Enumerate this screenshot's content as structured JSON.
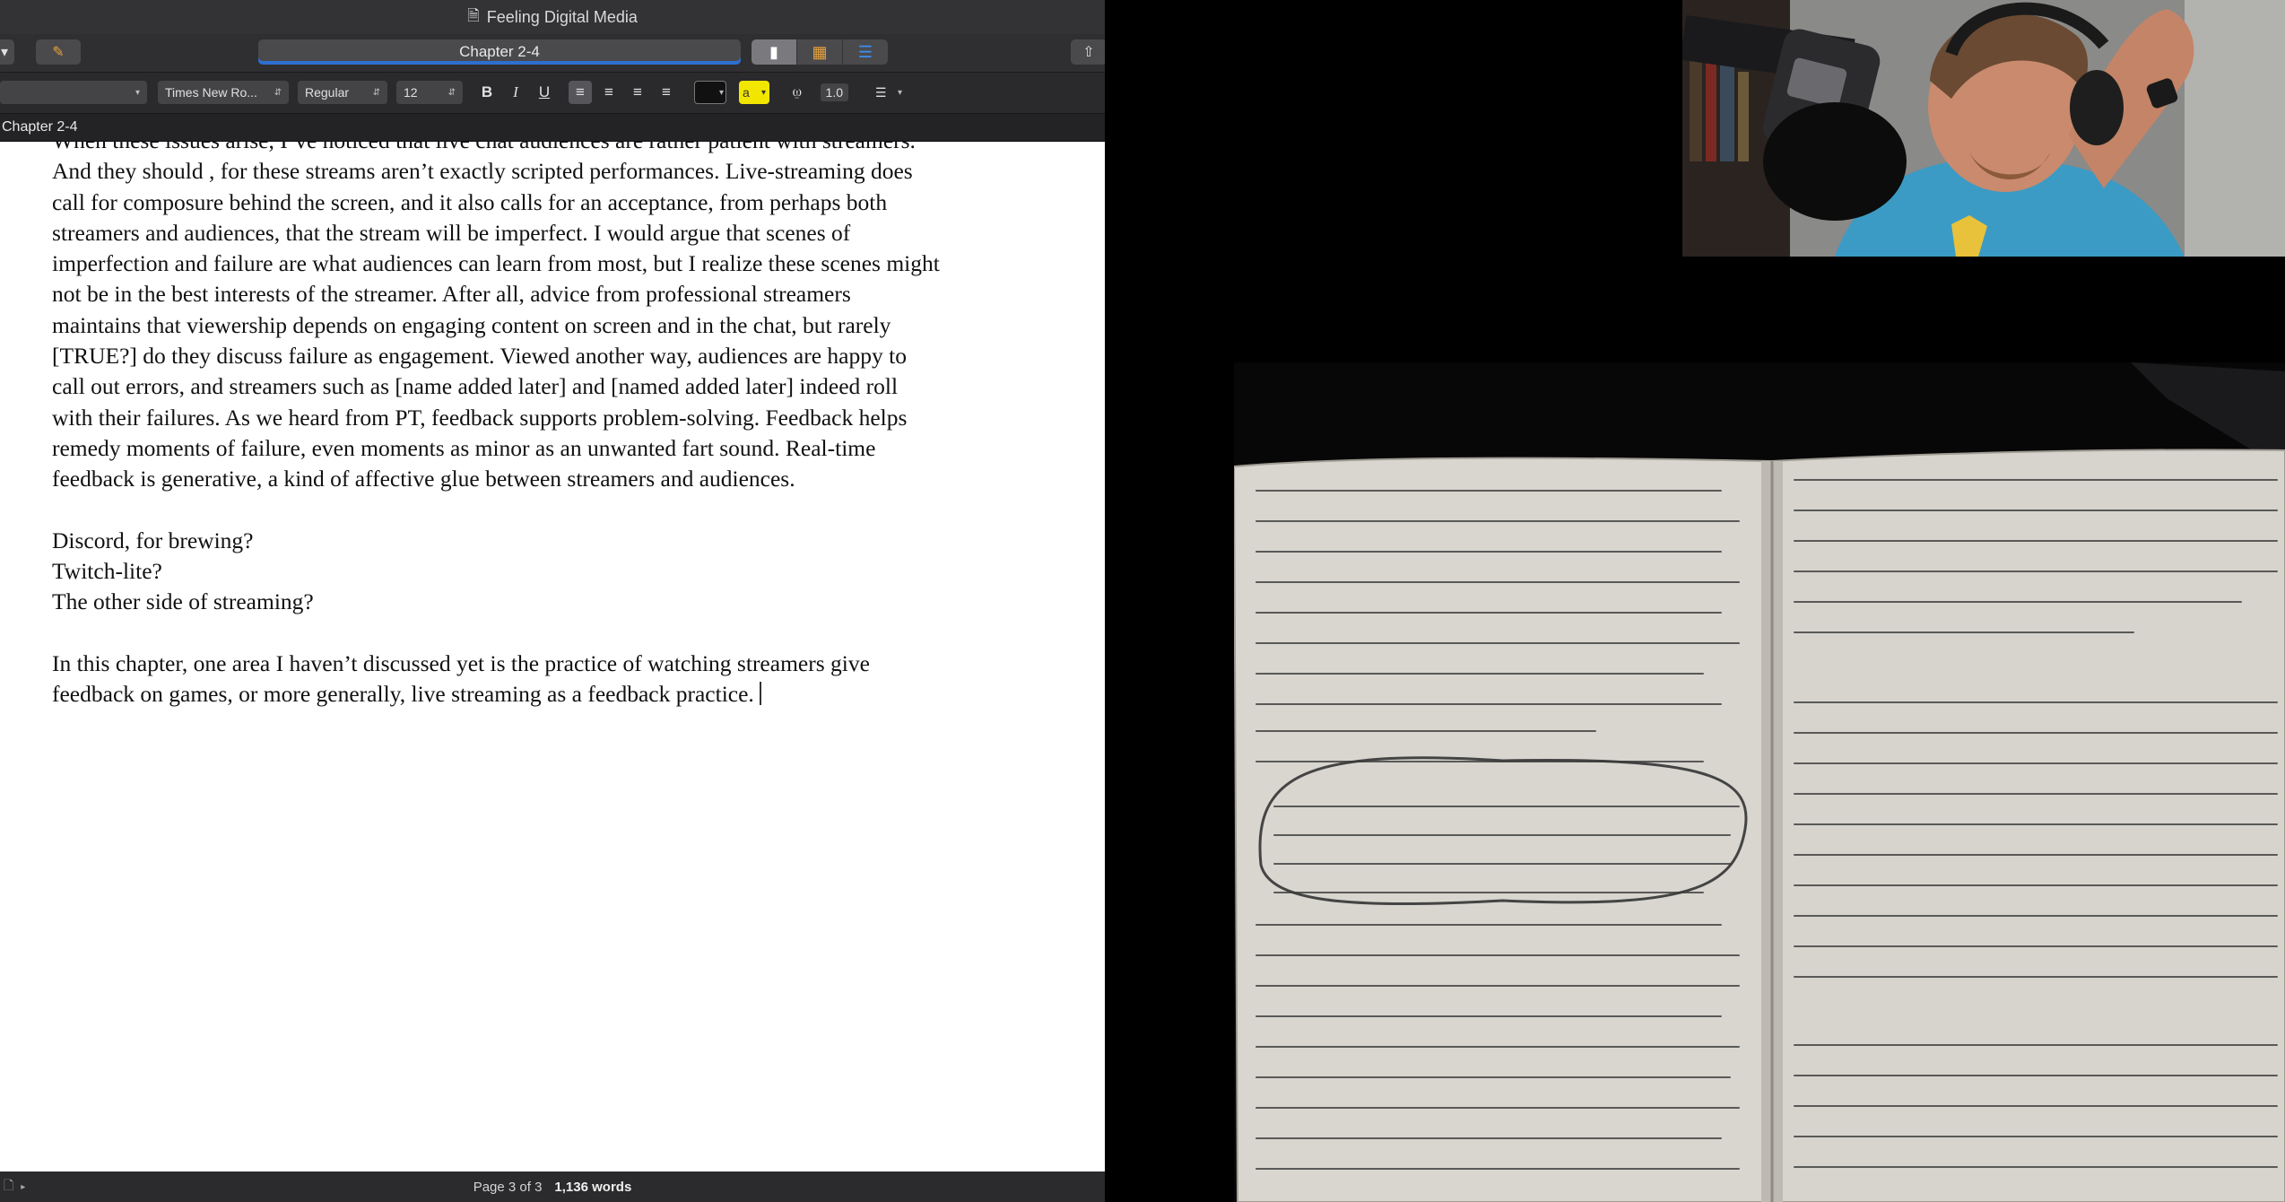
{
  "window": {
    "title": "Feeling Digital Media"
  },
  "toolbar": {
    "chapter_field": "Chapter 2-4"
  },
  "format_bar": {
    "font_family": "Times New Ro...",
    "font_style": "Regular",
    "font_size": "12",
    "line_spacing": "1.0",
    "highlight_label": "a"
  },
  "editor": {
    "header_title": "Chapter 2-4",
    "cut_off_line": "When these issues arise, I’ve noticed that live chat audiences are rather patient with streamers.",
    "paragraph1_lines": [
      "And they should , for these streams aren’t exactly scripted performances. Live-streaming does",
      "call for composure behind the screen, and it also calls for an acceptance, from perhaps both",
      "streamers and audiences, that the stream will be imperfect. I would argue that scenes of",
      "imperfection and failure are what audiences can learn from most, but I realize these scenes might",
      "not be in the best interests of the streamer. After all, advice from professional streamers",
      "maintains that viewership depends on engaging content on screen and in the chat, but rarely",
      "[TRUE?] do they discuss failure as engagement. Viewed another way, audiences are happy to",
      "call out errors, and streamers such as [name added later] and [named added later] indeed roll",
      "with their failures. As we heard from PT, feedback supports problem-solving. Feedback helps",
      "remedy moments of failure, even moments as minor as an unwanted fart sound. Real-time",
      "feedback is generative, a kind of affective glue between streamers and audiences."
    ],
    "notes": [
      "Discord, for brewing?",
      "Twitch-lite?",
      "The other side of streaming?"
    ],
    "paragraph2_lines": [
      "In this chapter, one area I haven’t discussed yet is the practice of watching streamers give",
      "feedback on games, or more generally, live streaming as a feedback practice."
    ]
  },
  "footer": {
    "page_label": "Page 3 of 3",
    "word_count": "1,136 words"
  },
  "icons": {
    "title_doc": "document-icon",
    "toolbar_left": "chevron-left-icon",
    "toolbar_compose": "compose-icon",
    "view_document": "single-document-view-icon",
    "view_corkboard": "corkboard-icon",
    "view_outline": "outline-icon",
    "share": "share-icon",
    "bold": "bold-icon",
    "italic": "italic-icon",
    "underline": "underline-icon",
    "align_left": "align-left-icon",
    "align_center": "align-center-icon",
    "align_right": "align-right-icon",
    "justify": "justify-icon",
    "list": "list-icon"
  },
  "colors": {
    "accent_blue": "#2d6fd0",
    "corkboard_orange": "#e8a33c",
    "highlight_yellow": "#f2e600"
  }
}
